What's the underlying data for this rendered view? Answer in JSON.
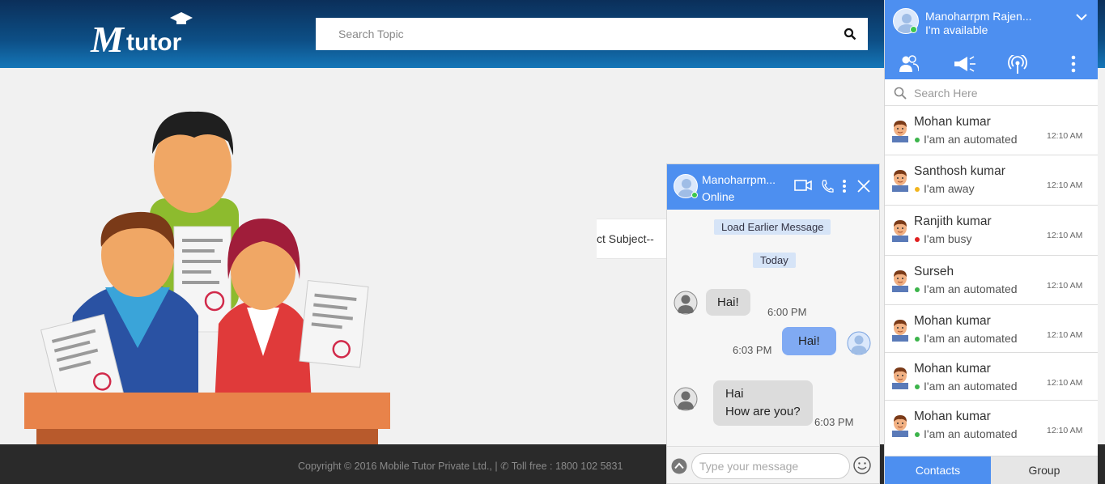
{
  "header": {
    "logo_text": "Mtutor",
    "search_placeholder": "Search Topic"
  },
  "main": {
    "subject_select_visible": "ct Subject--"
  },
  "footer": {
    "text": "Copyright © 2016 Mobile Tutor Private Ltd., | ✆ Toll free : 1800 102 5831"
  },
  "chat": {
    "contact_name": "Manoharrpm...",
    "status": "Online",
    "load_earlier": "Load Earlier Message",
    "date_chip": "Today",
    "messages": [
      {
        "direction": "in",
        "lines": [
          "Hai!"
        ],
        "time": "6:00 PM"
      },
      {
        "direction": "out",
        "lines": [
          "Hai!"
        ],
        "time": "6:03 PM"
      },
      {
        "direction": "in",
        "lines": [
          "Hai",
          "How are you?"
        ],
        "time": "6:03 PM"
      }
    ],
    "input_placeholder": "Type your message"
  },
  "panel": {
    "user_name": "Manoharrpm Rajen...",
    "user_status": "I'm available",
    "search_placeholder": "Search Here",
    "contacts": [
      {
        "name": "Mohan kumar",
        "status": "I'am an automated",
        "time": "12:10 AM",
        "presence_color": "#3cb44b"
      },
      {
        "name": "Santhosh kumar",
        "status": "I'am away",
        "time": "12:10 AM",
        "presence_color": "#f2b51f"
      },
      {
        "name": "Ranjith kumar",
        "status": "I'am busy",
        "time": "12:10 AM",
        "presence_color": "#e02020"
      },
      {
        "name": "Surseh",
        "status": "I'am an automated",
        "time": "12:10 AM",
        "presence_color": "#3cb44b"
      },
      {
        "name": "Mohan kumar",
        "status": "I'am an automated",
        "time": "12:10 AM",
        "presence_color": "#3cb44b"
      },
      {
        "name": "Mohan kumar",
        "status": "I'am an automated",
        "time": "12:10 AM",
        "presence_color": "#3cb44b"
      },
      {
        "name": "Mohan kumar",
        "status": "I'am an automated",
        "time": "12:10 AM",
        "presence_color": "#3cb44b"
      }
    ],
    "tabs": {
      "contacts": "Contacts",
      "group": "Group"
    }
  },
  "colors": {
    "accent": "#4d8ff0",
    "header_dark": "#0b2f5a",
    "footer": "#2a2a2a"
  }
}
